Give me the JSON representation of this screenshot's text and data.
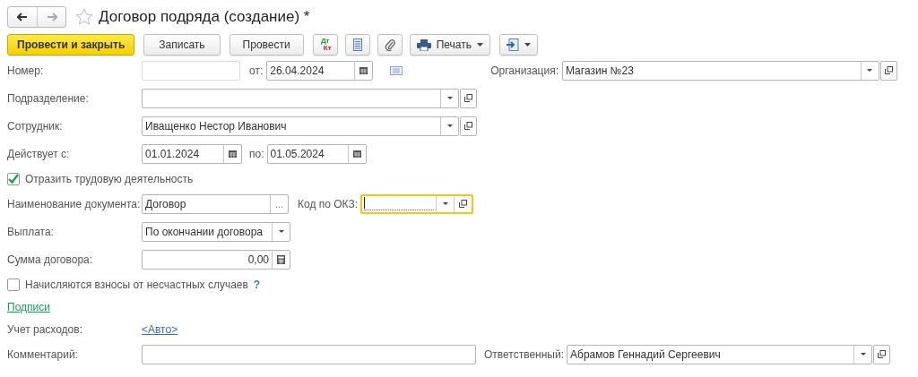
{
  "window": {
    "title": "Договор подряда (создание) *",
    "favorite": false
  },
  "toolbar": [
    {
      "kind": "primary",
      "label": "Провести и закрыть"
    },
    {
      "kind": "plain",
      "label": "Записать"
    },
    {
      "kind": "plain",
      "label": "Провести"
    },
    {
      "kind": "dtkt",
      "top": "Дт",
      "bottom": "Кт"
    },
    {
      "kind": "list"
    },
    {
      "kind": "clip"
    },
    {
      "kind": "print",
      "label": "Печать"
    },
    {
      "kind": "export"
    }
  ],
  "number": {
    "label": "Номер:"
  },
  "date": {
    "label": "от:",
    "value": "26.04.2024"
  },
  "organization": {
    "label": "Организация:",
    "value": "Магазин №23"
  },
  "department": {
    "label": "Подразделение:"
  },
  "employee": {
    "label": "Сотрудник:",
    "value": "Иващенко Нестор Иванович"
  },
  "period": {
    "label": "Действует с:",
    "from": "01.01.2024",
    "to_label": "по:",
    "to": "01.05.2024"
  },
  "reflect_labor": {
    "label": "Отразить трудовую деятельность",
    "checked": true
  },
  "doc_name": {
    "label": "Наименование документа:",
    "value": "Договор",
    "button": "..."
  },
  "okz": {
    "label": "Код по ОКЗ:",
    "focused": true
  },
  "payment": {
    "label": "Выплата:",
    "value": "По окончании договора"
  },
  "sum": {
    "label": "Сумма договора:",
    "value": "0,00"
  },
  "accident": {
    "label": "Начисляются взносы от несчастных случаев",
    "checked": false,
    "help": "?"
  },
  "signatures_link": "Подписи",
  "expense": {
    "label": "Учет расходов:",
    "link": "<Авто>"
  },
  "comment": {
    "label": "Комментарий:"
  },
  "responsible": {
    "label": "Ответственный:",
    "value": "Абрамов Геннадий Сергеевич"
  }
}
